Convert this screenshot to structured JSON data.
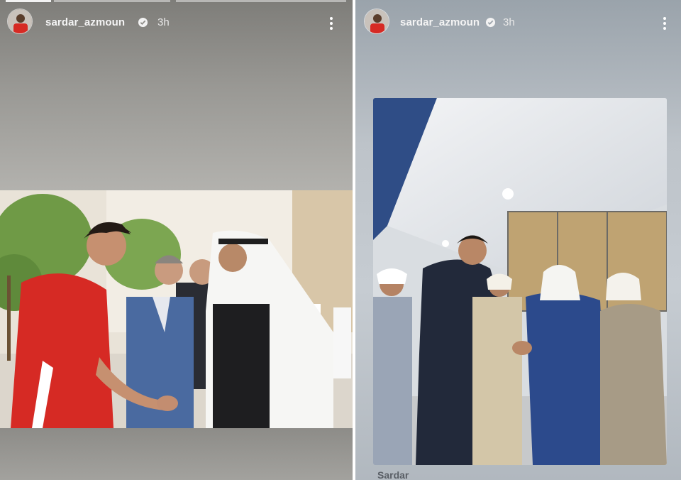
{
  "stories": [
    {
      "username": "sardar_azmoun",
      "timestamp": "3h",
      "verified": true,
      "avatar_icon": "profile-avatar",
      "menu_icon": "more-vertical-icon",
      "photo_description_icon": "story-photo"
    },
    {
      "username": "sardar_azmoun",
      "timestamp": "3h",
      "verified": true,
      "avatar_icon": "profile-avatar",
      "menu_icon": "more-vertical-icon",
      "photo_description_icon": "story-photo",
      "caption_partial": "Sardar"
    }
  ],
  "colors": {
    "verified_badge": "#f2f2f2",
    "username_text": "#f4f4f4",
    "jersey_red": "#d62a24"
  }
}
